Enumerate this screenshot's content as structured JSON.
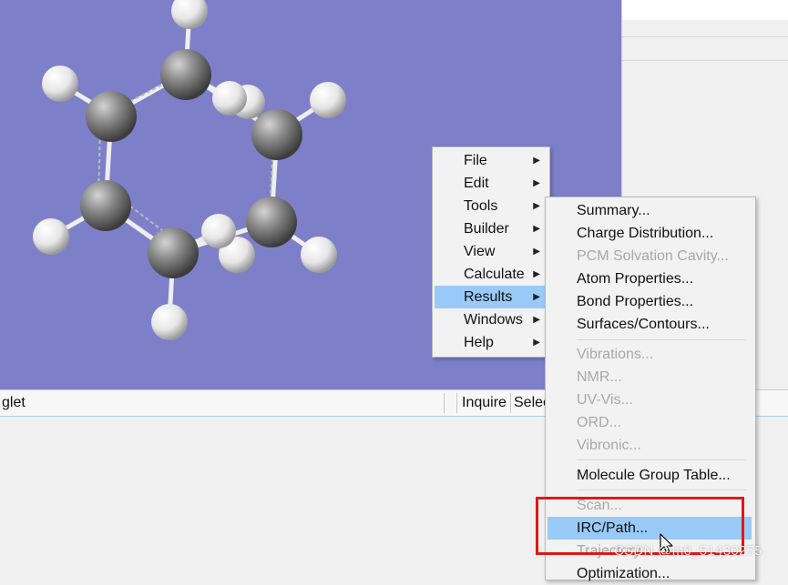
{
  "status": {
    "multiplicity_fragment": "glet",
    "inquire_label": "Inquire",
    "select_fragment": "Selec"
  },
  "main_menu": {
    "items": [
      {
        "label": "File",
        "submenu": true
      },
      {
        "label": "Edit",
        "submenu": true
      },
      {
        "label": "Tools",
        "submenu": true
      },
      {
        "label": "Builder",
        "submenu": true
      },
      {
        "label": "View",
        "submenu": true
      },
      {
        "label": "Calculate",
        "submenu": true
      },
      {
        "label": "Results",
        "submenu": true,
        "highlighted": true
      },
      {
        "label": "Windows",
        "submenu": true
      },
      {
        "label": "Help",
        "submenu": true
      }
    ]
  },
  "results_menu": {
    "items": [
      {
        "label": "Summary...",
        "enabled": true
      },
      {
        "label": "Charge Distribution...",
        "enabled": true
      },
      {
        "label": "PCM Solvation Cavity...",
        "enabled": false
      },
      {
        "label": "Atom Properties...",
        "enabled": true
      },
      {
        "label": "Bond Properties...",
        "enabled": true
      },
      {
        "label": "Surfaces/Contours...",
        "enabled": true
      },
      {
        "label": "Vibrations...",
        "enabled": false
      },
      {
        "label": "NMR...",
        "enabled": false
      },
      {
        "label": "UV-Vis...",
        "enabled": false
      },
      {
        "label": "ORD...",
        "enabled": false
      },
      {
        "label": "Vibronic...",
        "enabled": false
      },
      {
        "label": "Molecule Group Table...",
        "enabled": true
      },
      {
        "label": "Scan...",
        "enabled": false
      },
      {
        "label": "IRC/Path...",
        "enabled": true,
        "highlighted": true
      },
      {
        "label": "Trajectory...",
        "enabled": false
      },
      {
        "label": "Optimization...",
        "enabled": true
      }
    ]
  },
  "watermark": "CSDN @m0_51430275",
  "colors": {
    "viewport_bg": "#7d80c9",
    "menu_highlight": "#99c9f7",
    "annotation_red": "#e01818"
  }
}
